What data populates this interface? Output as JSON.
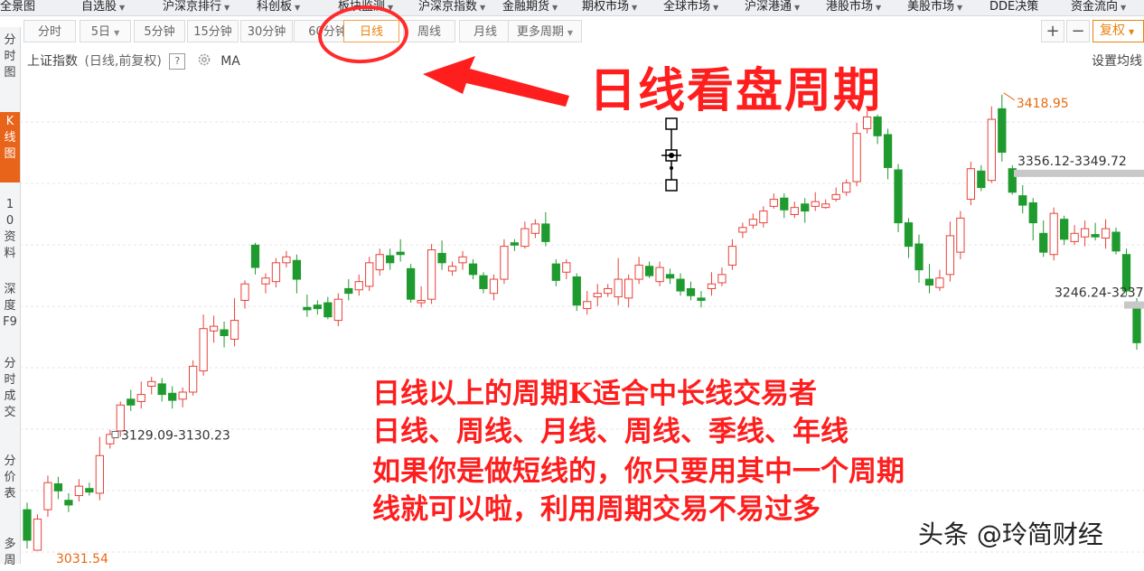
{
  "top_nav": [
    {
      "label": "全景图",
      "caret": false
    },
    {
      "label": "自选股",
      "caret": true
    },
    {
      "label": "沪深京排行",
      "caret": true
    },
    {
      "label": "科创板",
      "caret": true
    },
    {
      "label": "板块监测",
      "caret": true
    },
    {
      "label": "沪深京指数",
      "caret": true
    },
    {
      "label": "金融期货",
      "caret": true
    },
    {
      "label": "期权市场",
      "caret": true
    },
    {
      "label": "全球市场",
      "caret": true
    },
    {
      "label": "沪深港通",
      "caret": true
    },
    {
      "label": "港股市场",
      "caret": true
    },
    {
      "label": "美股市场",
      "caret": true
    },
    {
      "label": "DDE决策",
      "caret": false
    },
    {
      "label": "资金流向",
      "caret": true
    }
  ],
  "period_buttons": [
    {
      "label": "分时",
      "caret": false,
      "active": false
    },
    {
      "label": "5日",
      "caret": true,
      "active": false
    },
    {
      "label": "5分钟",
      "caret": false,
      "active": false
    },
    {
      "label": "15分钟",
      "caret": false,
      "active": false
    },
    {
      "label": "30分钟",
      "caret": false,
      "active": false
    },
    {
      "label": "60分钟",
      "caret": false,
      "active": false
    },
    {
      "label": "日线",
      "caret": false,
      "active": true
    },
    {
      "label": "周线",
      "caret": false,
      "active": false
    },
    {
      "label": "月线",
      "caret": false,
      "active": false
    },
    {
      "label": "更多周期",
      "caret": true,
      "active": false
    }
  ],
  "toolbar_right": {
    "plus": "+",
    "minus": "−",
    "fq": "复权"
  },
  "left_tabs": [
    {
      "label": "分时图",
      "active": false
    },
    {
      "label": "K线图",
      "active": true
    },
    {
      "label": "10资料",
      "active": false
    },
    {
      "label": "深度F9",
      "active": false
    },
    {
      "label": "分时成交",
      "active": false
    },
    {
      "label": "分价表",
      "active": false
    },
    {
      "label": "多周",
      "active": false
    }
  ],
  "chart_header": {
    "name": "上证指数",
    "mode": "(日线,前复权)",
    "help": "?",
    "ma": "MA",
    "settings": "设置均线"
  },
  "annotations": {
    "title": "日线看盘周期",
    "lines": [
      "日线以上的周期K适合中长线交易者",
      "日线、周线、月线、周线、季线、年线",
      "如果你是做短线的，你只要用其中一个周期",
      "线就可以啦，利用周期交易不易过多"
    ],
    "watermark": "头条 @玲简财经"
  },
  "colors": {
    "up": "#e8413a",
    "down": "#1f9a2f",
    "annotation": "#ff1e1e",
    "active_tab": "#e8641a"
  },
  "chart_data": {
    "type": "candlestick",
    "title": "上证指数",
    "price_labels": {
      "high": "3418.95",
      "low": "3031.54",
      "level1": "3356.12-3349.72",
      "level2": "3246.24-3237",
      "level3": "3129.09-3130.23"
    },
    "candles": [
      {
        "o": 3066,
        "c": 3040,
        "h": 3072,
        "l": 3033
      },
      {
        "o": 3031.54,
        "c": 3058,
        "h": 3062,
        "l": 3031.54
      },
      {
        "o": 3066,
        "c": 3089,
        "h": 3095,
        "l": 3060
      },
      {
        "o": 3088,
        "c": 3082,
        "h": 3094,
        "l": 3075
      },
      {
        "o": 3074,
        "c": 3070,
        "h": 3080,
        "l": 3064
      },
      {
        "o": 3078,
        "c": 3086,
        "h": 3092,
        "l": 3073
      },
      {
        "o": 3084,
        "c": 3081,
        "h": 3089,
        "l": 3078
      },
      {
        "o": 3080,
        "c": 3112,
        "h": 3128,
        "l": 3074
      },
      {
        "o": 3122,
        "c": 3130,
        "h": 3134,
        "l": 3118
      },
      {
        "o": 3133,
        "c": 3155,
        "h": 3158,
        "l": 3128
      },
      {
        "o": 3160,
        "c": 3155,
        "h": 3168,
        "l": 3150
      },
      {
        "o": 3158,
        "c": 3164,
        "h": 3175,
        "l": 3152
      },
      {
        "o": 3171,
        "c": 3175,
        "h": 3179,
        "l": 3164
      },
      {
        "o": 3173,
        "c": 3164,
        "h": 3178,
        "l": 3158
      },
      {
        "o": 3165,
        "c": 3159,
        "h": 3171,
        "l": 3152
      },
      {
        "o": 3160,
        "c": 3166,
        "h": 3170,
        "l": 3153
      },
      {
        "o": 3166,
        "c": 3188,
        "h": 3193,
        "l": 3163
      },
      {
        "o": 3184,
        "c": 3220,
        "h": 3232,
        "l": 3180
      },
      {
        "o": 3218,
        "c": 3222,
        "h": 3231,
        "l": 3208
      },
      {
        "o": 3219,
        "c": 3214,
        "h": 3226,
        "l": 3204
      },
      {
        "o": 3211,
        "c": 3227,
        "h": 3246,
        "l": 3205
      },
      {
        "o": 3244,
        "c": 3258,
        "h": 3261,
        "l": 3237
      },
      {
        "o": 3291,
        "c": 3272,
        "h": 3293,
        "l": 3266
      },
      {
        "o": 3258,
        "c": 3263,
        "h": 3267,
        "l": 3250
      },
      {
        "o": 3260,
        "c": 3276,
        "h": 3280,
        "l": 3255
      },
      {
        "o": 3276,
        "c": 3281,
        "h": 3286,
        "l": 3272
      },
      {
        "o": 3278,
        "c": 3262,
        "h": 3283,
        "l": 3250
      },
      {
        "o": 3238,
        "c": 3236,
        "h": 3249,
        "l": 3230
      },
      {
        "o": 3240,
        "c": 3237,
        "h": 3244,
        "l": 3232
      },
      {
        "o": 3242,
        "c": 3230,
        "h": 3247,
        "l": 3228
      },
      {
        "o": 3227,
        "c": 3245,
        "h": 3250,
        "l": 3222
      },
      {
        "o": 3254,
        "c": 3250,
        "h": 3262,
        "l": 3244
      },
      {
        "o": 3253,
        "c": 3260,
        "h": 3266,
        "l": 3248
      },
      {
        "o": 3256,
        "c": 3276,
        "h": 3281,
        "l": 3252
      },
      {
        "o": 3270,
        "c": 3283,
        "h": 3288,
        "l": 3265
      },
      {
        "o": 3282,
        "c": 3276,
        "h": 3288,
        "l": 3270
      },
      {
        "o": 3285,
        "c": 3283,
        "h": 3296,
        "l": 3277
      },
      {
        "o": 3271,
        "c": 3245,
        "h": 3275,
        "l": 3242
      },
      {
        "o": 3242,
        "c": 3244,
        "h": 3256,
        "l": 3238
      },
      {
        "o": 3245,
        "c": 3287,
        "h": 3292,
        "l": 3241
      },
      {
        "o": 3284,
        "c": 3276,
        "h": 3295,
        "l": 3270
      },
      {
        "o": 3269,
        "c": 3273,
        "h": 3277,
        "l": 3265
      },
      {
        "o": 3276,
        "c": 3281,
        "h": 3286,
        "l": 3270
      },
      {
        "o": 3275,
        "c": 3266,
        "h": 3279,
        "l": 3262
      },
      {
        "o": 3265,
        "c": 3254,
        "h": 3268,
        "l": 3250
      },
      {
        "o": 3250,
        "c": 3262,
        "h": 3266,
        "l": 3244
      },
      {
        "o": 3262,
        "c": 3290,
        "h": 3296,
        "l": 3258
      },
      {
        "o": 3293,
        "c": 3291,
        "h": 3296,
        "l": 3286
      },
      {
        "o": 3290,
        "c": 3305,
        "h": 3311,
        "l": 3288
      },
      {
        "o": 3301,
        "c": 3309,
        "h": 3313,
        "l": 3297
      },
      {
        "o": 3309,
        "c": 3294,
        "h": 3319,
        "l": 3290
      },
      {
        "o": 3275,
        "c": 3261,
        "h": 3279,
        "l": 3256
      },
      {
        "o": 3268,
        "c": 3276,
        "h": 3279,
        "l": 3262
      },
      {
        "o": 3264,
        "c": 3240,
        "h": 3267,
        "l": 3235
      },
      {
        "o": 3237,
        "c": 3243,
        "h": 3252,
        "l": 3232
      },
      {
        "o": 3247,
        "c": 3250,
        "h": 3258,
        "l": 3239
      },
      {
        "o": 3250,
        "c": 3254,
        "h": 3258,
        "l": 3247
      },
      {
        "o": 3247,
        "c": 3262,
        "h": 3280,
        "l": 3240
      },
      {
        "o": 3246,
        "c": 3262,
        "h": 3266,
        "l": 3238
      },
      {
        "o": 3262,
        "c": 3274,
        "h": 3281,
        "l": 3258
      },
      {
        "o": 3273,
        "c": 3265,
        "h": 3277,
        "l": 3263
      },
      {
        "o": 3260,
        "c": 3272,
        "h": 3277,
        "l": 3256
      },
      {
        "o": 3266,
        "c": 3263,
        "h": 3271,
        "l": 3258
      },
      {
        "o": 3262,
        "c": 3252,
        "h": 3267,
        "l": 3248
      },
      {
        "o": 3254,
        "c": 3248,
        "h": 3260,
        "l": 3244
      },
      {
        "o": 3246,
        "c": 3244,
        "h": 3252,
        "l": 3238
      },
      {
        "o": 3254,
        "c": 3258,
        "h": 3268,
        "l": 3248
      },
      {
        "o": 3259,
        "c": 3266,
        "h": 3272,
        "l": 3256
      },
      {
        "o": 3274,
        "c": 3290,
        "h": 3296,
        "l": 3270
      },
      {
        "o": 3302,
        "c": 3306,
        "h": 3310,
        "l": 3297
      },
      {
        "o": 3308,
        "c": 3313,
        "h": 3318,
        "l": 3305
      },
      {
        "o": 3310,
        "c": 3320,
        "h": 3324,
        "l": 3306
      },
      {
        "o": 3324,
        "c": 3330,
        "h": 3335,
        "l": 3322
      },
      {
        "o": 3331,
        "c": 3321,
        "h": 3335,
        "l": 3314
      },
      {
        "o": 3317,
        "c": 3323,
        "h": 3328,
        "l": 3314
      },
      {
        "o": 3326,
        "c": 3320,
        "h": 3331,
        "l": 3310
      },
      {
        "o": 3324,
        "c": 3328,
        "h": 3336,
        "l": 3320
      },
      {
        "o": 3323,
        "c": 3326,
        "h": 3330,
        "l": 3322
      },
      {
        "o": 3330,
        "c": 3334,
        "h": 3340,
        "l": 3328
      },
      {
        "o": 3336,
        "c": 3344,
        "h": 3347,
        "l": 3333
      },
      {
        "o": 3345,
        "c": 3386,
        "h": 3395,
        "l": 3341
      },
      {
        "o": 3390,
        "c": 3400,
        "h": 3405,
        "l": 3386
      },
      {
        "o": 3400,
        "c": 3384,
        "h": 3402,
        "l": 3377
      },
      {
        "o": 3385,
        "c": 3357,
        "h": 3390,
        "l": 3347
      },
      {
        "o": 3355,
        "c": 3310,
        "h": 3360,
        "l": 3302
      },
      {
        "o": 3310,
        "c": 3290,
        "h": 3314,
        "l": 3280
      },
      {
        "o": 3292,
        "c": 3270,
        "h": 3300,
        "l": 3259
      },
      {
        "o": 3262,
        "c": 3257,
        "h": 3275,
        "l": 3250
      },
      {
        "o": 3255,
        "c": 3263,
        "h": 3270,
        "l": 3252
      },
      {
        "o": 3266,
        "c": 3299,
        "h": 3311,
        "l": 3260
      },
      {
        "o": 3285,
        "c": 3314,
        "h": 3320,
        "l": 3279
      },
      {
        "o": 3330,
        "c": 3356,
        "h": 3362,
        "l": 3325
      },
      {
        "o": 3354,
        "c": 3340,
        "h": 3359,
        "l": 3337
      },
      {
        "o": 3346,
        "c": 3398,
        "h": 3409,
        "l": 3344
      },
      {
        "o": 3407,
        "c": 3370,
        "h": 3418.95,
        "l": 3362
      },
      {
        "o": 3356,
        "c": 3336,
        "h": 3359,
        "l": 3334
      },
      {
        "o": 3333,
        "c": 3325,
        "h": 3342,
        "l": 3318
      },
      {
        "o": 3327,
        "c": 3310,
        "h": 3331,
        "l": 3295
      },
      {
        "o": 3301,
        "c": 3285,
        "h": 3312,
        "l": 3281
      },
      {
        "o": 3283,
        "c": 3318,
        "h": 3323,
        "l": 3278
      },
      {
        "o": 3313,
        "c": 3296,
        "h": 3316,
        "l": 3291
      },
      {
        "o": 3294,
        "c": 3301,
        "h": 3308,
        "l": 3291
      },
      {
        "o": 3298,
        "c": 3305,
        "h": 3312,
        "l": 3290
      },
      {
        "o": 3300,
        "c": 3298,
        "h": 3310,
        "l": 3295
      },
      {
        "o": 3297,
        "c": 3305,
        "h": 3313,
        "l": 3288
      },
      {
        "o": 3302,
        "c": 3286,
        "h": 3306,
        "l": 3283
      },
      {
        "o": 3283,
        "c": 3252,
        "h": 3288,
        "l": 3248
      },
      {
        "o": 3240,
        "c": 3208,
        "h": 3246,
        "l": 3202
      }
    ]
  }
}
